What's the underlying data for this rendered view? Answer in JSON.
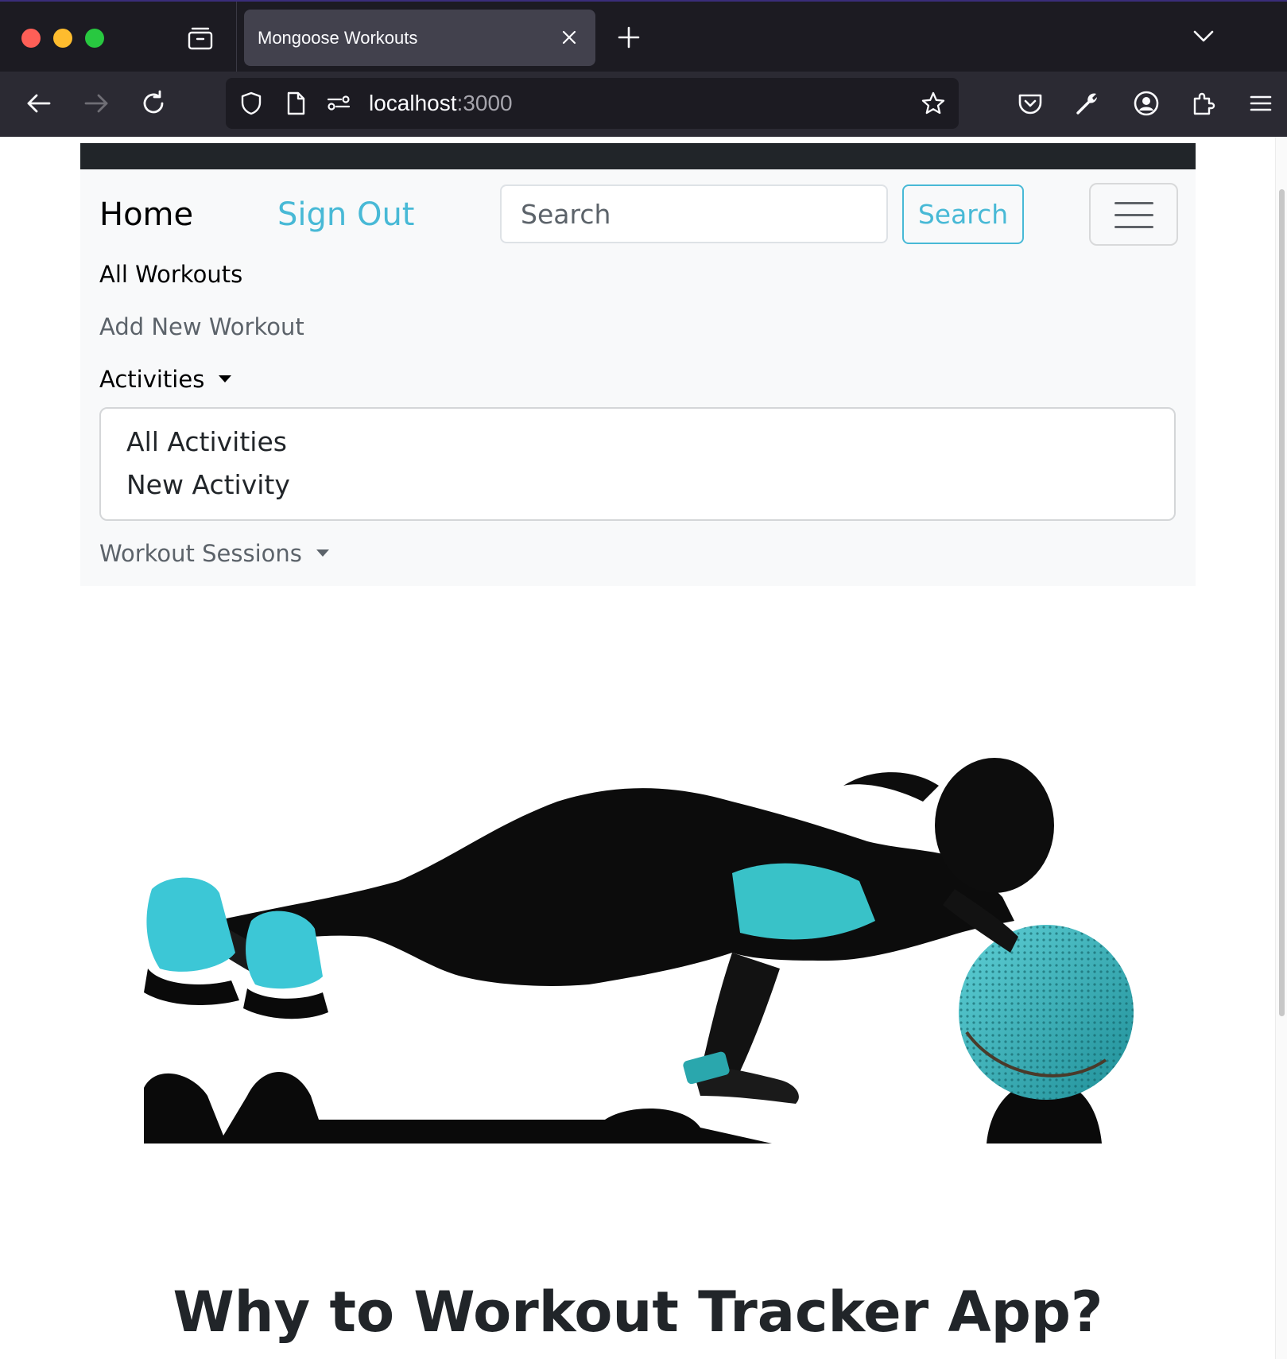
{
  "browser": {
    "tab_title": "Mongoose Workouts",
    "url_host": "localhost",
    "url_port": ":3000",
    "accent_color": "#48b9d6"
  },
  "navbar": {
    "brand": "Home",
    "sign_out": "Sign Out",
    "search": {
      "placeholder": "Search",
      "value": "",
      "button_label": "Search"
    },
    "links": [
      {
        "label": "All Workouts"
      },
      {
        "label": "Add New Workout"
      }
    ],
    "activities": {
      "label": "Activities",
      "items": [
        "All Activities",
        "New Activity"
      ]
    },
    "workout_sessions": {
      "label": "Workout Sessions"
    }
  },
  "main": {
    "heading": "Why to Workout Tracker App?"
  },
  "colors": {
    "navbar_bg": "#f8f9fa",
    "dark_strip": "#212529",
    "text_dark": "#212529",
    "text_muted": "#5c636a"
  }
}
